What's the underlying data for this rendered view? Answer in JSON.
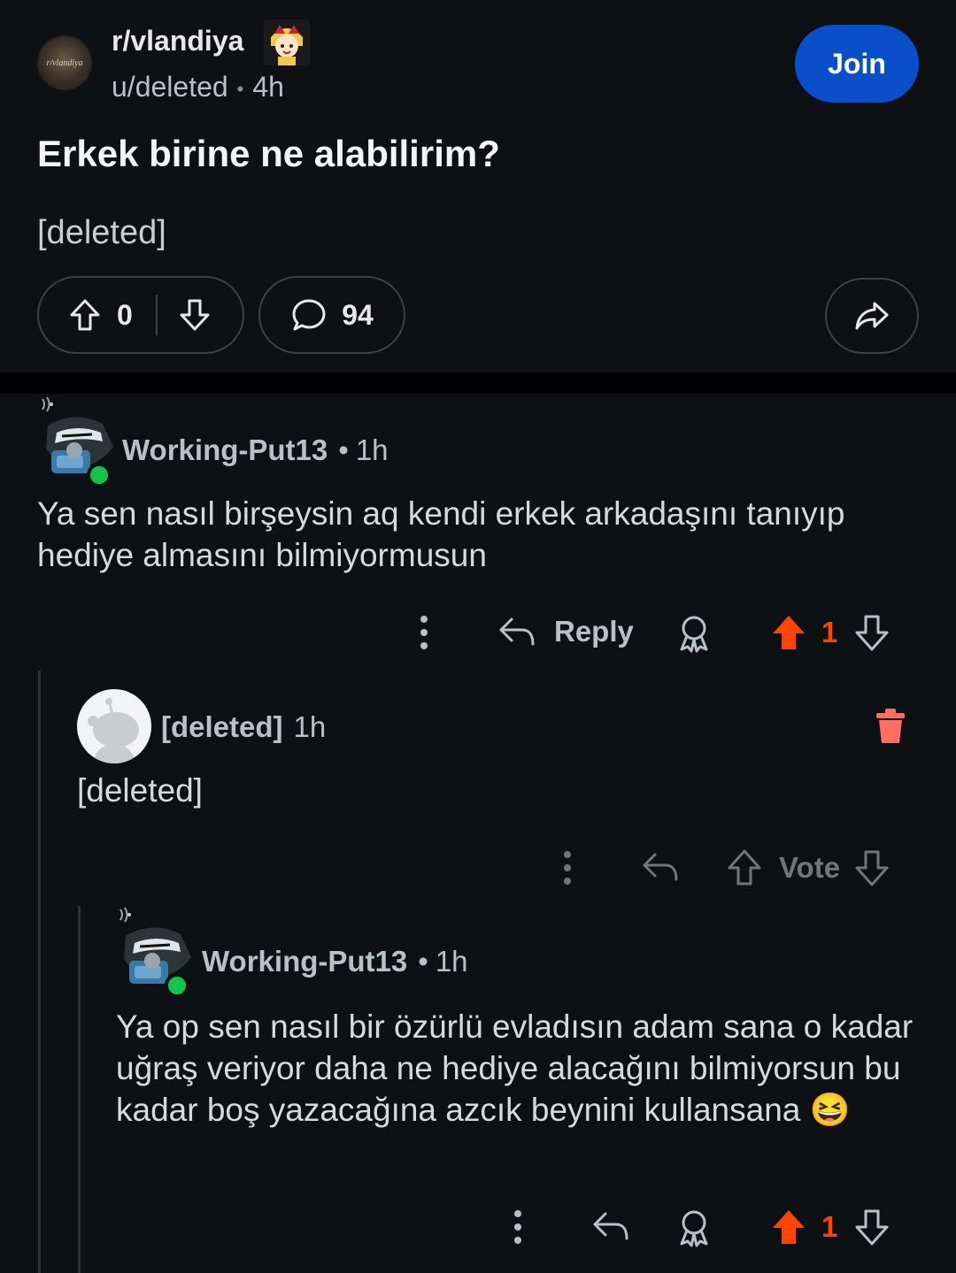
{
  "post": {
    "subreddit": "r/vlandiya",
    "subreddit_avatar_text": "r/vlandiya",
    "author": "u/deleted",
    "time": "4h",
    "join_label": "Join",
    "title": "Erkek birine ne alabilirim?",
    "body": "[deleted]",
    "score": "0",
    "comments": "94"
  },
  "comments": [
    {
      "author": "Working-Put13",
      "time": "1h",
      "text": "Ya sen nasıl birşeysin aq kendi erkek arkadaşını tanıyıp hediye almasını bilmiyormusun",
      "reply_label": "Reply",
      "score": "1"
    },
    {
      "author": "[deleted]",
      "time": "1h",
      "text": "[deleted]",
      "vote_label": "Vote"
    },
    {
      "author": "Working-Put13",
      "time": "1h",
      "text": "Ya op sen nasıl bir özürlü evladısın adam sana o kadar uğraş veriyor daha ne hediye alacağını bilmiyorsun bu kadar boş yazacağına azcık beynini kullansana 😆",
      "score": "1"
    }
  ],
  "colors": {
    "background": "#0e1113",
    "join": "#0a4fc9",
    "upvote_active": "#ff4500",
    "delete": "#ff6f61",
    "online": "#14c34a"
  }
}
